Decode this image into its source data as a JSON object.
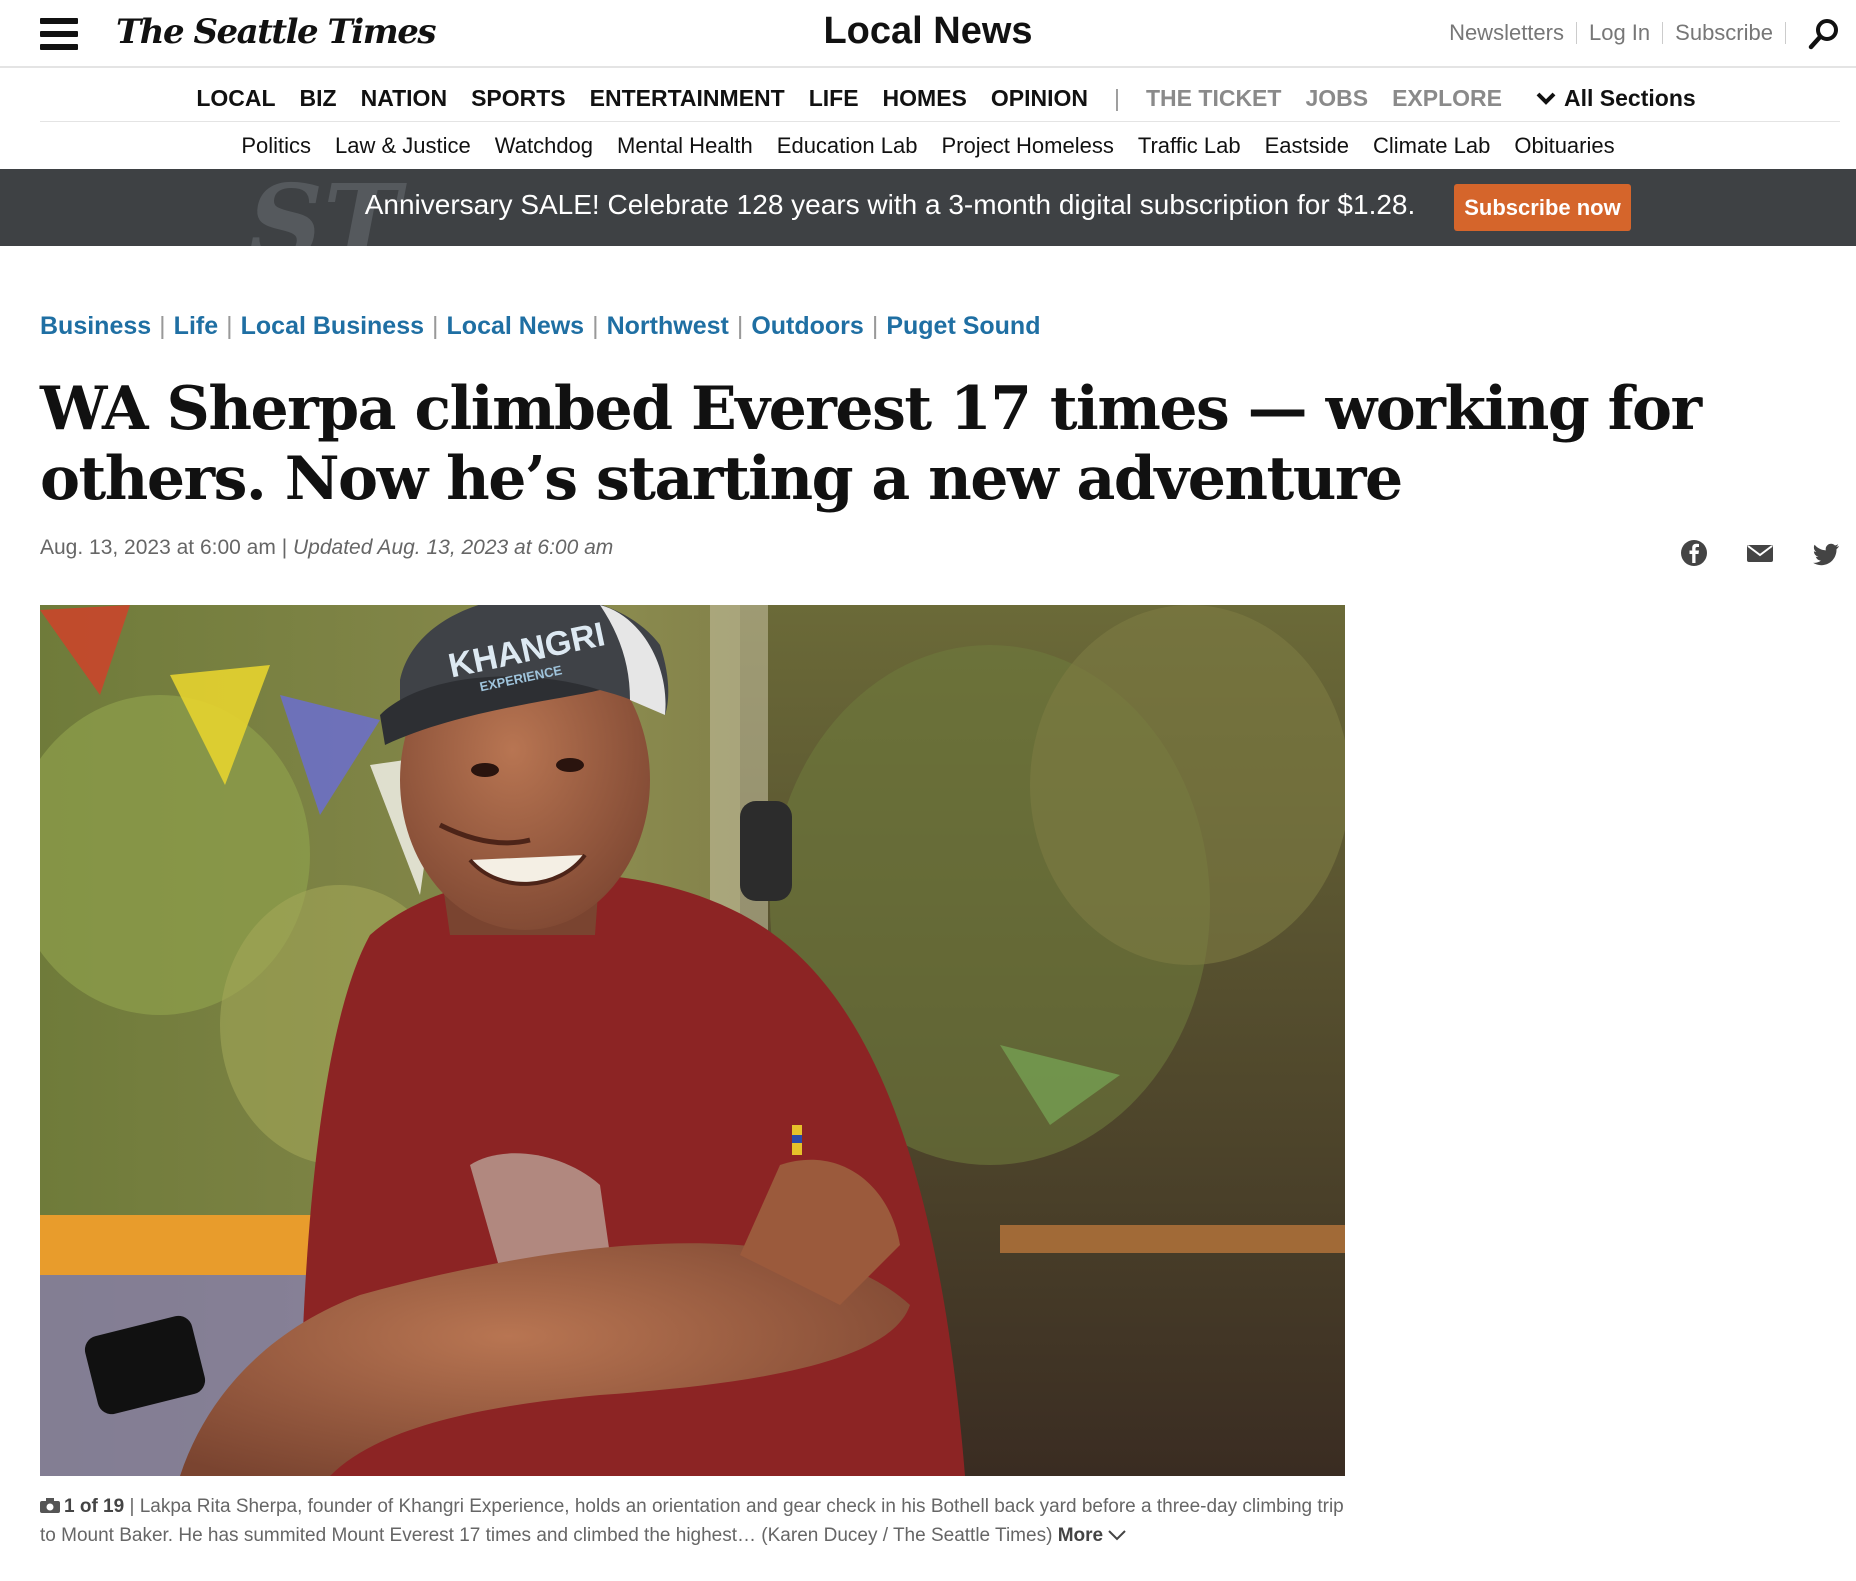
{
  "header": {
    "logo": "The Seattle Times",
    "section_title": "Local News",
    "links": [
      "Newsletters",
      "Log In",
      "Subscribe"
    ]
  },
  "main_nav": {
    "items": [
      "LOCAL",
      "BIZ",
      "NATION",
      "SPORTS",
      "ENTERTAINMENT",
      "LIFE",
      "HOMES",
      "OPINION"
    ],
    "secondary": [
      "THE TICKET",
      "JOBS",
      "EXPLORE"
    ],
    "all_sections": "All Sections"
  },
  "sub_nav": {
    "items": [
      "Politics",
      "Law & Justice",
      "Watchdog",
      "Mental Health",
      "Education Lab",
      "Project Homeless",
      "Traffic Lab",
      "Eastside",
      "Climate Lab",
      "Obituaries"
    ]
  },
  "banner": {
    "monogram": "ST",
    "message": "Anniversary SALE! Celebrate 128 years with a 3-month digital subscription for $1.28.",
    "cta": "Subscribe now"
  },
  "article": {
    "tags": [
      "Business",
      "Life",
      "Local Business",
      "Local News",
      "Northwest",
      "Outdoors",
      "Puget Sound"
    ],
    "headline": "WA Sherpa climbed Everest 17 times — working for others. Now he’s starting a new adventure",
    "published": "Aug. 13, 2023 at 6:00 am",
    "updated": "Updated Aug. 13, 2023 at 6:00 am",
    "photo_cap_text": "KHANGRI",
    "photo_cap_subtext": "EXPERIENCE",
    "caption": {
      "counter": "1 of 19",
      "text": "Lakpa Rita Sherpa, founder of Khangri Experience, holds an orientation and gear check in his Bothell back yard before a three-day climbing trip to Mount Baker. He has summited Mount Everest 17 times and climbed the highest… (Karen Ducey / The Seattle Times)",
      "more": "More"
    }
  },
  "colors": {
    "accent_link": "#1f6fa3",
    "banner_bg": "#3e4144",
    "cta_bg": "#d5652b"
  }
}
